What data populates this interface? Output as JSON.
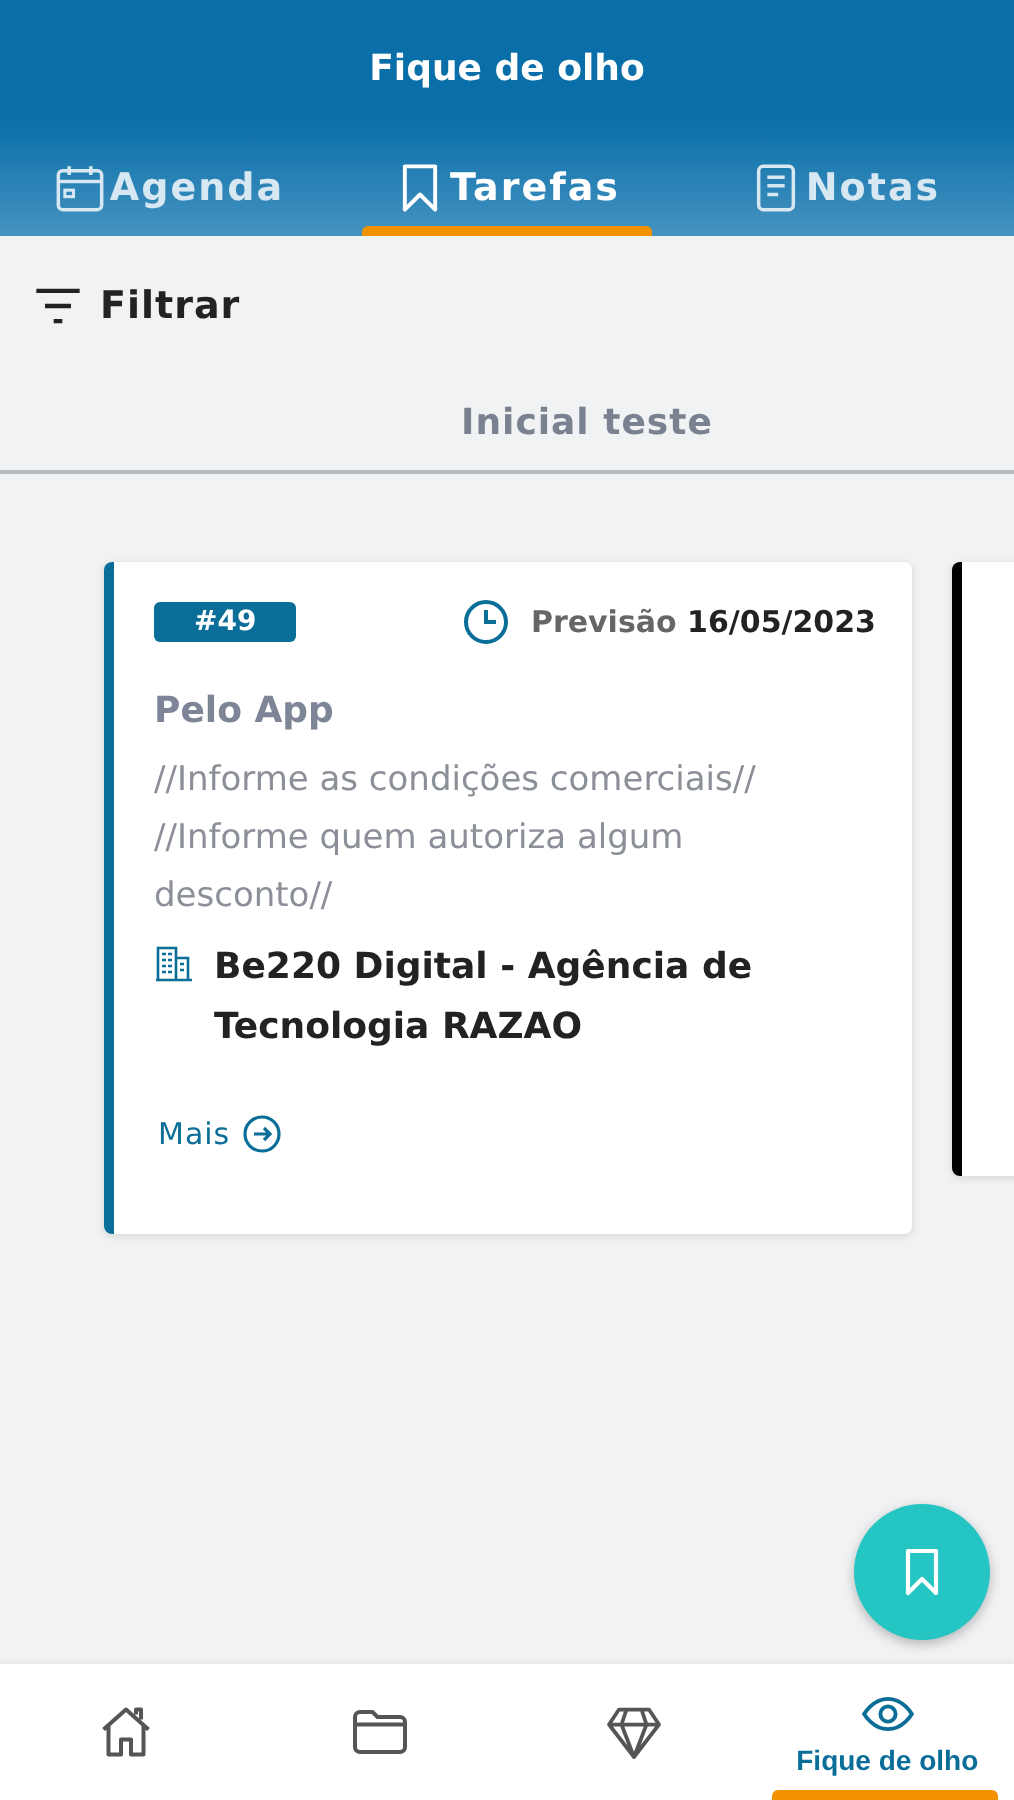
{
  "header": {
    "title": "Fique de olho"
  },
  "tabs": [
    {
      "kind": "calendar",
      "label": "Agenda",
      "selected": false
    },
    {
      "kind": "bookmark",
      "label": "Tarefas",
      "selected": true
    },
    {
      "kind": "note",
      "label": "Notas",
      "selected": false
    }
  ],
  "filter": {
    "label": "Filtrar"
  },
  "column": {
    "title": "Inicial teste"
  },
  "cards": [
    {
      "color": "#0b6e99",
      "number": "#49",
      "forecast_label": "Previsão",
      "forecast_date": "16/05/2023",
      "title": "Pelo App",
      "description": "//Informe as condições comerciais// //Informe quem autoriza algum desconto//",
      "company": "Be220 Digital - Agência de Tecnologia RAZAO",
      "more": "Mais"
    },
    {
      "color": "#000000"
    }
  ],
  "bottom_nav": [
    {
      "kind": "home",
      "selected": false
    },
    {
      "kind": "folder",
      "selected": false
    },
    {
      "kind": "diamond",
      "selected": false
    },
    {
      "kind": "eye",
      "label": "Fique de olho",
      "selected": true
    }
  ]
}
